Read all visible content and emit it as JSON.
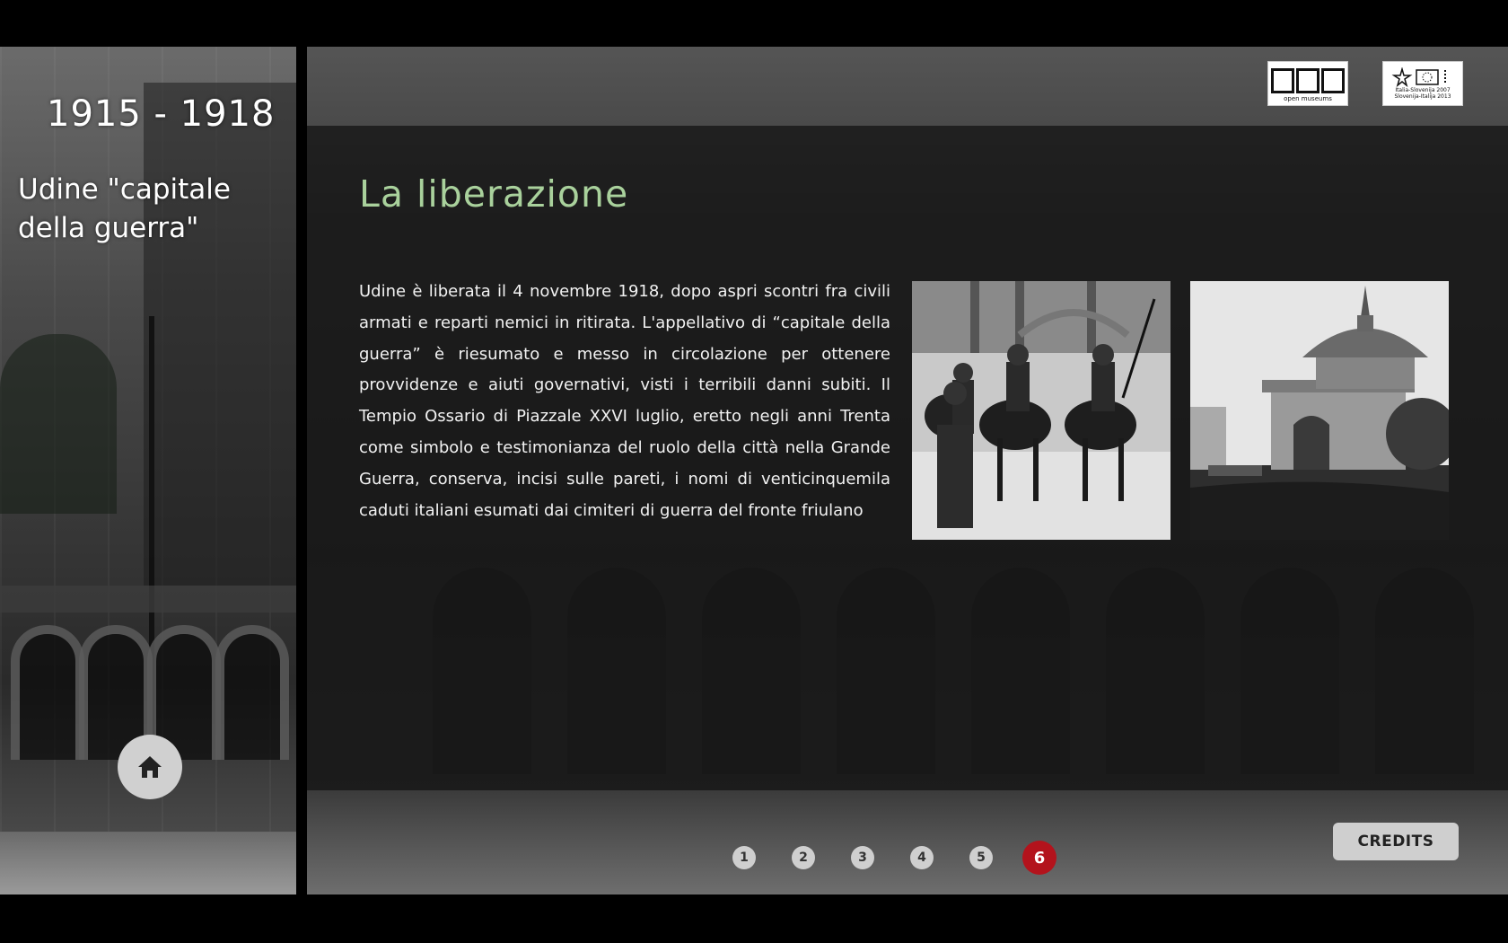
{
  "sidebar": {
    "years": "1915 - 1918",
    "subtitle_line1": "Udine \"capitale",
    "subtitle_line2": "della guerra\"",
    "home_icon": "home-icon"
  },
  "header": {
    "logo_open_museums": "open museums",
    "logo_eu_line1": "Italia-Slovenija 2007",
    "logo_eu_line2": "Slovenija-Italija 2013"
  },
  "main": {
    "title": "La liberazione",
    "body": "Udine è liberata il 4 novembre 1918, dopo aspri scontri fra civili armati e reparti nemici in ritirata. L'appellativo di “capitale della guerra” è riesumato e messo in circolazione per ottenere provvidenze e aiuti governativi, visti i terribili danni subiti. Il Tempio Ossario di Piazzale XXVI luglio, eretto negli anni Trenta come simbolo e testimonianza del ruolo della città nella Grande Guerra, conserva, incisi sulle pareti, i nomi di venticinquemila caduti italiani esumati dai cimiteri di guerra del fronte friulano"
  },
  "pager": {
    "pages": [
      "1",
      "2",
      "3",
      "4",
      "5",
      "6"
    ],
    "active": "6"
  },
  "footer": {
    "credits_label": "CREDITS"
  },
  "colors": {
    "title_green": "#a9d19c",
    "active_page_red": "#b3131c",
    "button_gray": "#cfcfcf"
  }
}
